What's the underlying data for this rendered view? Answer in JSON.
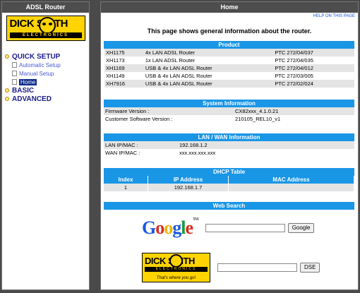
{
  "sidebar": {
    "title": "ADSL Router",
    "logo_alt": "DICK SMITH ELECTRONICS",
    "logo_word": "DICK  SMITH",
    "logo_band": "ELECTRONICS",
    "nav": [
      {
        "label": "QUICK SETUP",
        "children": [
          "Automatic Setup",
          "Manual Setup",
          "Home"
        ]
      },
      {
        "label": "BASIC"
      },
      {
        "label": "ADVANCED"
      }
    ],
    "active_item": "Home"
  },
  "main": {
    "title": "Home",
    "help_link": "HELP ON THIS PAGE",
    "intro": "This page shows general information about the router."
  },
  "product": {
    "header": "Product",
    "rows": [
      [
        "XH1175",
        "4x LAN ADSL Router",
        "PTC 272/04/037"
      ],
      [
        "XH1173",
        "1x LAN ADSL Router",
        "PTC 272/04/035"
      ],
      [
        "XH1169",
        "USB & 4x LAN ADSL Router",
        "PTC 272/04/012"
      ],
      [
        "XH1149",
        "USB & 4x LAN ADSL Router",
        "PTC 272/03/005"
      ],
      [
        "XH7916",
        "USB & 4x LAN ADSL Router",
        "PTC 272/02/024"
      ]
    ]
  },
  "system": {
    "header": "System Information",
    "firmware_label": "Firmware Version :",
    "firmware_value": "CX82xxx_4.1.0.21",
    "customer_label": "Customer Software Version :",
    "customer_value": "210105_REL10_v1"
  },
  "lanwan": {
    "header": "LAN / WAN Information",
    "lan_label": "LAN IP/MAC :",
    "lan_value": "192.168.1.2",
    "wan_label": "WAN IP/MAC :",
    "wan_value": "xxx.xxx.xxx.xxx"
  },
  "dhcp": {
    "header": "DHCP Table",
    "columns": [
      "Index",
      "IP Address",
      "MAC Address"
    ],
    "rows": [
      [
        "1",
        "192.168.1.7",
        ""
      ]
    ]
  },
  "websearch": {
    "header": "Web Search",
    "google_button": "Google",
    "dse_button": "DSE",
    "ds_tagline": "That's where you go!"
  },
  "colors": {
    "accent": "#1a96e6",
    "titlebar": "#4d4d4d",
    "nav": "#1a1a8c"
  }
}
